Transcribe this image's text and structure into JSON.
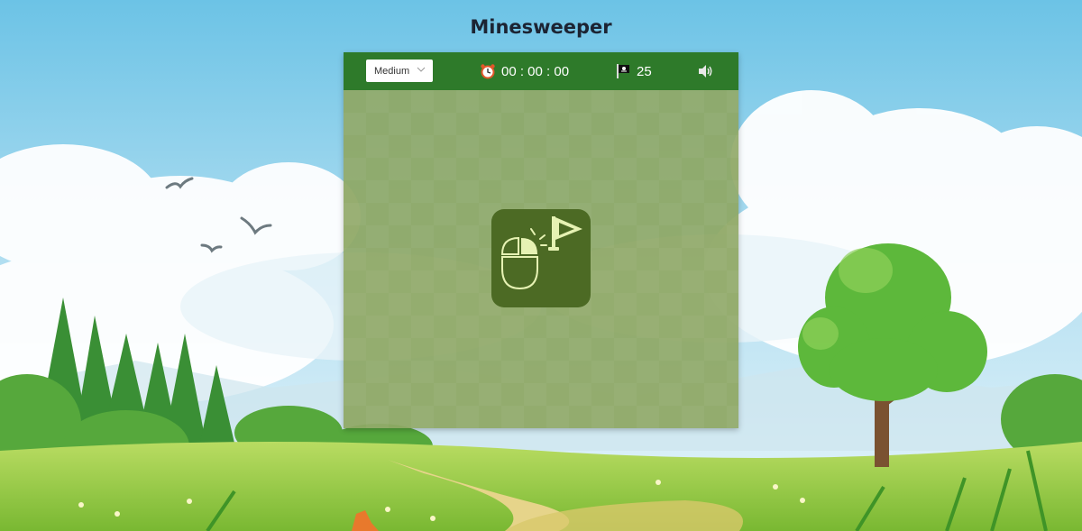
{
  "header": {
    "title": "Minesweeper"
  },
  "toolbar": {
    "difficulty": {
      "selected": "Medium"
    },
    "timer": "00 : 00 : 00",
    "flags_remaining": "25",
    "sound_icon": "speaker-icon",
    "clock_icon": "alarm-clock-icon",
    "flag_icon": "pirate-flag-icon"
  },
  "board": {
    "hint_icon": "mouse-right-click-flag-icon"
  },
  "colors": {
    "topbar": "#2e7a2a",
    "board": "#8fa865",
    "hint_tile": "#4c6a24",
    "title": "#1c2433"
  }
}
